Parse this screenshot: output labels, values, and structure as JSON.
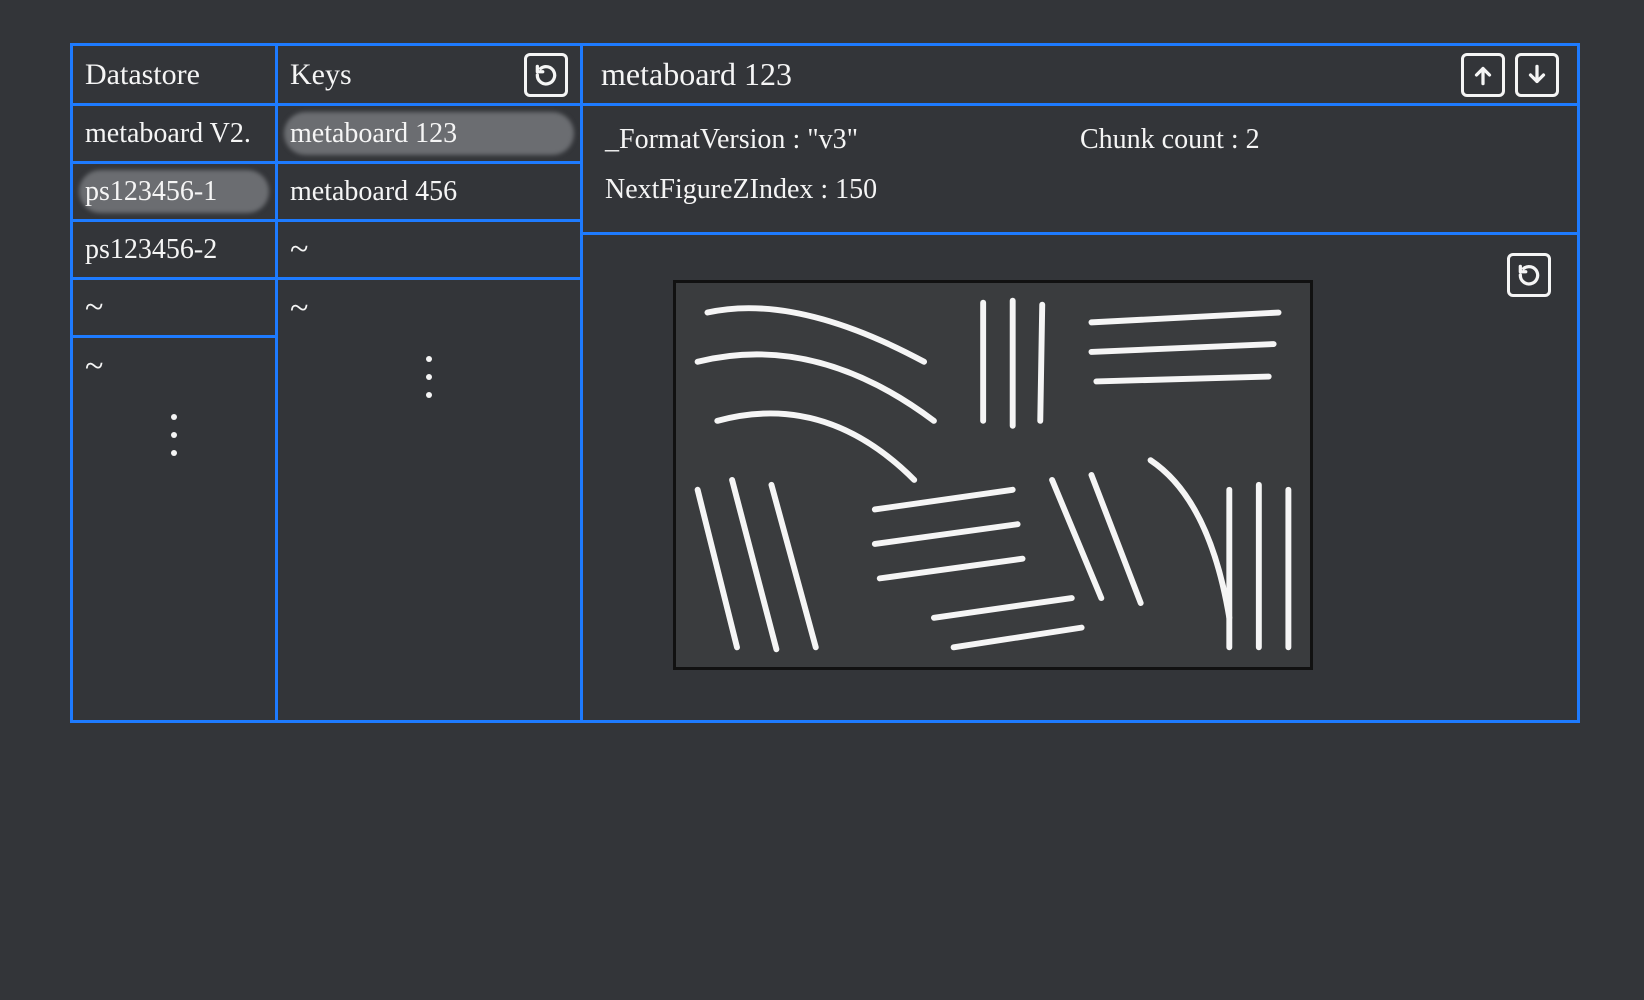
{
  "columns": {
    "datastore": {
      "title": "Datastore",
      "items": [
        "metaboard V2.",
        "ps123456-1",
        "ps123456-2",
        "~",
        "~"
      ],
      "selected_index": 1
    },
    "keys": {
      "title": "Keys",
      "items": [
        "metaboard 123",
        "metaboard 456",
        "~",
        "~"
      ],
      "selected_index": 0
    }
  },
  "detail": {
    "title": "metaboard 123",
    "meta": {
      "format_version_label": "_FormatVersion",
      "format_version_value": "\"v3\"",
      "chunk_count_label": "Chunk count",
      "chunk_count_value": "2",
      "next_figure_zindex_label": "NextFigureZIndex",
      "next_figure_zindex_value": "150"
    }
  },
  "icons": {
    "refresh": "refresh-icon",
    "upload": "upload-icon",
    "download": "download-icon"
  },
  "colors": {
    "border_blue": "#1e7bff",
    "bg": "#333539",
    "fg": "#f5f5f5",
    "highlight": "#6b6d71"
  }
}
